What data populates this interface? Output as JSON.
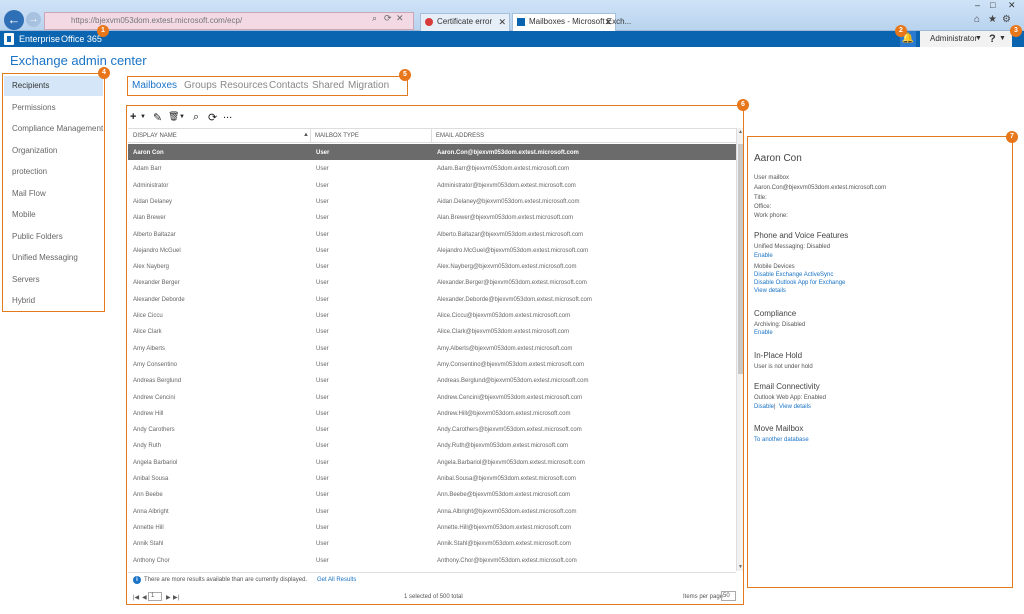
{
  "browser": {
    "url": "https://bjexvm053dom.extest.microsoft.com/ecp/",
    "tabs": [
      {
        "label": "Certificate error"
      },
      {
        "label": "Mailboxes - Microsoft Exch..."
      }
    ]
  },
  "top_bar": {
    "enterprise": "Enterprise",
    "office365": "Office 365",
    "user": "Administrator",
    "help": "?"
  },
  "page_title": "Exchange admin center",
  "nav": [
    {
      "label": "Recipients",
      "selected": true
    },
    {
      "label": "Permissions"
    },
    {
      "label": "Compliance Management"
    },
    {
      "label": "Organization"
    },
    {
      "label": "protection"
    },
    {
      "label": "Mail Flow"
    },
    {
      "label": "Mobile"
    },
    {
      "label": "Public Folders"
    },
    {
      "label": "Unified Messaging"
    },
    {
      "label": "Servers"
    },
    {
      "label": "Hybrid"
    }
  ],
  "tabs": [
    "Mailboxes",
    "Groups",
    "Resources",
    "Contacts",
    "Shared",
    "Migration"
  ],
  "toolbar": {
    "add": "+",
    "edit": "✎",
    "delete": "🗑",
    "search": "⌕",
    "refresh": "⟳",
    "more": "..."
  },
  "columns": [
    "DISPLAY NAME",
    "MAILBOX TYPE",
    "EMAIL ADDRESS"
  ],
  "rows": [
    {
      "name": "Aaron Con",
      "type": "User",
      "email": "Aaron.Con@bjexvm053dom.extest.microsoft.com",
      "selected": true
    },
    {
      "name": "Adam Barr",
      "type": "User",
      "email": "Adam.Barr@bjexvm053dom.extest.microsoft.com"
    },
    {
      "name": "Administrator",
      "type": "User",
      "email": "Administrator@bjexvm053dom.extest.microsoft.com"
    },
    {
      "name": "Aidan Delaney",
      "type": "User",
      "email": "Aidan.Delaney@bjexvm053dom.extest.microsoft.com"
    },
    {
      "name": "Alan Brewer",
      "type": "User",
      "email": "Alan.Brewer@bjexvm053dom.extest.microsoft.com"
    },
    {
      "name": "Alberto Baltazar",
      "type": "User",
      "email": "Alberto.Baltazar@bjexvm053dom.extest.microsoft.com"
    },
    {
      "name": "Alejandro McGuel",
      "type": "User",
      "email": "Alejandro.McGuel@bjexvm053dom.extest.microsoft.com"
    },
    {
      "name": "Alex Nayberg",
      "type": "User",
      "email": "Alex.Nayberg@bjexvm053dom.extest.microsoft.com"
    },
    {
      "name": "Alexander Berger",
      "type": "User",
      "email": "Alexander.Berger@bjexvm053dom.extest.microsoft.com"
    },
    {
      "name": "Alexander Deborde",
      "type": "User",
      "email": "Alexander.Deborde@bjexvm053dom.extest.microsoft.com"
    },
    {
      "name": "Alice Ciccu",
      "type": "User",
      "email": "Alice.Ciccu@bjexvm053dom.extest.microsoft.com"
    },
    {
      "name": "Alice Clark",
      "type": "User",
      "email": "Alice.Clark@bjexvm053dom.extest.microsoft.com"
    },
    {
      "name": "Amy Alberts",
      "type": "User",
      "email": "Amy.Alberts@bjexvm053dom.extest.microsoft.com"
    },
    {
      "name": "Amy Consentino",
      "type": "User",
      "email": "Amy.Consentino@bjexvm053dom.extest.microsoft.com"
    },
    {
      "name": "Andreas Berglund",
      "type": "User",
      "email": "Andreas.Berglund@bjexvm053dom.extest.microsoft.com"
    },
    {
      "name": "Andrew Cencini",
      "type": "User",
      "email": "Andrew.Cencini@bjexvm053dom.extest.microsoft.com"
    },
    {
      "name": "Andrew Hill",
      "type": "User",
      "email": "Andrew.Hill@bjexvm053dom.extest.microsoft.com"
    },
    {
      "name": "Andy Carothers",
      "type": "User",
      "email": "Andy.Carothers@bjexvm053dom.extest.microsoft.com"
    },
    {
      "name": "Andy Ruth",
      "type": "User",
      "email": "Andy.Ruth@bjexvm053dom.extest.microsoft.com"
    },
    {
      "name": "Angela Barbariol",
      "type": "User",
      "email": "Angela.Barbariol@bjexvm053dom.extest.microsoft.com"
    },
    {
      "name": "Anibal Sousa",
      "type": "User",
      "email": "Anibal.Sousa@bjexvm053dom.extest.microsoft.com"
    },
    {
      "name": "Ann Beebe",
      "type": "User",
      "email": "Ann.Beebe@bjexvm053dom.extest.microsoft.com"
    },
    {
      "name": "Anna Albright",
      "type": "User",
      "email": "Anna.Albright@bjexvm053dom.extest.microsoft.com"
    },
    {
      "name": "Annette Hill",
      "type": "User",
      "email": "Annette.Hill@bjexvm053dom.extest.microsoft.com"
    },
    {
      "name": "Annik Stahl",
      "type": "User",
      "email": "Annik.Stahl@bjexvm053dom.extest.microsoft.com"
    },
    {
      "name": "Anthony Chor",
      "type": "User",
      "email": "Anthony.Chor@bjexvm053dom.extest.microsoft.com"
    }
  ],
  "info": {
    "text": "There are more results available than are currently displayed.",
    "link": "Get All Results"
  },
  "pager": {
    "page": "1",
    "status": "1 selected of 500 total",
    "ipp_label": "Items per page",
    "ipp": "50"
  },
  "details": {
    "name": "Aaron Con",
    "type": "User mailbox",
    "email": "Aaron.Con@bjexvm053dom.extest.microsoft.com",
    "title": "Title:",
    "office": "Office:",
    "work_phone": "Work phone:",
    "pv_heading": "Phone and Voice Features",
    "um": "Unified Messaging: Disabled",
    "enable1": "Enable",
    "mobile_devices": "Mobile Devices",
    "disable_eas": "Disable Exchange ActiveSync",
    "disable_owa": "Disable Outlook App for Exchange",
    "view_details1": "View details",
    "compliance_heading": "Compliance",
    "archiving": "Archiving: Disabled",
    "enable2": "Enable",
    "hold_heading": "In-Place Hold",
    "hold_status": "User is not under hold",
    "email_conn_heading": "Email Connectivity",
    "owa": "Outlook Web App: Enabled",
    "disable": "Disable",
    "sep": "|",
    "view_details2": "View details",
    "move_heading": "Move Mailbox",
    "move_link": "To another database"
  },
  "callouts": [
    "1",
    "2",
    "3",
    "4",
    "5",
    "6",
    "7"
  ],
  "colors": {
    "accent": "#1a73c6",
    "topbar": "#0a64b0",
    "callout": "#e8761a",
    "selected_row": "#6b6b6b"
  }
}
